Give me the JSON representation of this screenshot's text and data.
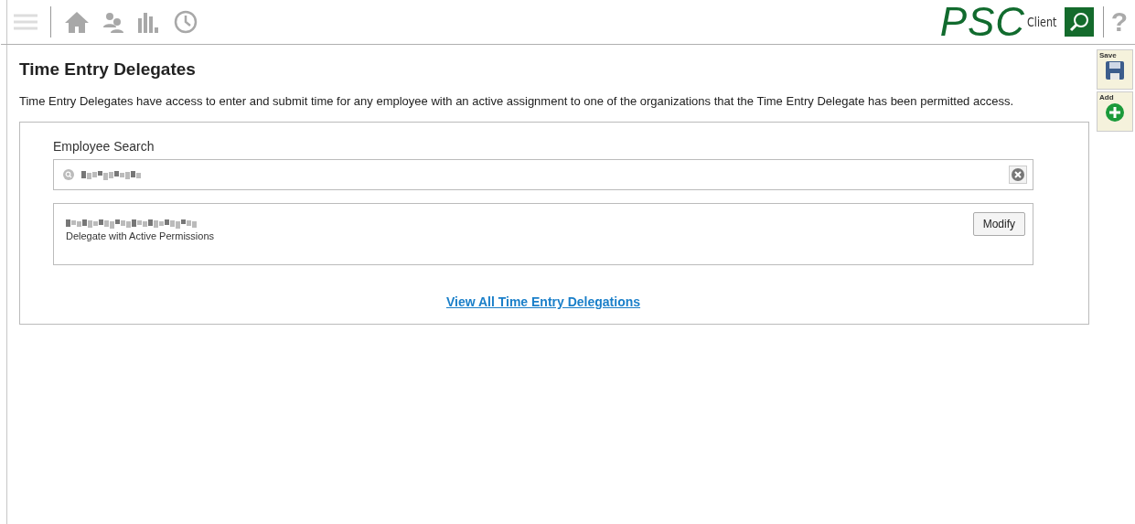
{
  "brand": {
    "name": "PSC",
    "sub": "Client"
  },
  "help": "?",
  "page": {
    "title": "Time Entry Delegates",
    "description": "Time Entry Delegates have access to enter and submit time for any employee with an active assignment to one of the organizations that the Time Entry Delegate has been permitted access."
  },
  "toolbar": [
    {
      "kind": "save",
      "label": "Save"
    },
    {
      "kind": "add",
      "label": "Add"
    }
  ],
  "search": {
    "label": "Employee Search"
  },
  "results": [
    {
      "status": "Delegate with Active Permissions",
      "action": "Modify"
    }
  ],
  "link": "View All Time Entry Delegations"
}
